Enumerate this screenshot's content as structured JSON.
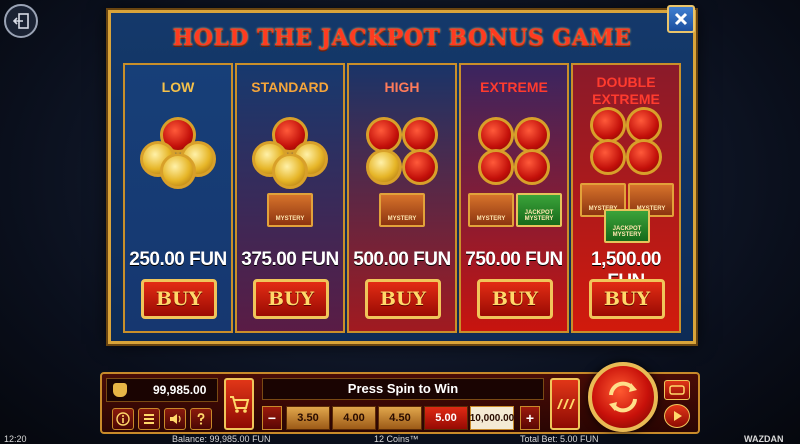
{
  "title": "HOLD THE JACKPOT BONUS GAME",
  "tiers": [
    {
      "name": "LOW",
      "price": "250.00 FUN",
      "buy": "BUY",
      "name_color": "#f5c14a",
      "bg_top": "#173f78",
      "bg_bottom": "#163770"
    },
    {
      "name": "STANDARD",
      "price": "375.00 FUN",
      "buy": "BUY",
      "name_color": "#f5a53a",
      "bg_top": "#17396e",
      "bg_bottom": "#5a1c45"
    },
    {
      "name": "HIGH",
      "price": "500.00 FUN",
      "buy": "BUY",
      "name_color": "#ff7b5a",
      "bg_top": "#1a3468",
      "bg_bottom": "#a11a20"
    },
    {
      "name": "EXTREME",
      "price": "750.00 FUN",
      "buy": "BUY",
      "name_color": "#ff3b2e",
      "bg_top": "#3a2560",
      "bg_bottom": "#c8140e"
    },
    {
      "name": "DOUBLE EXTREME",
      "name_line1": "DOUBLE",
      "name_line2": "EXTREME",
      "price": "1,500.00 FUN",
      "buy": "BUY",
      "name_color": "#ff3b2e",
      "bg_top": "#8a1a2a",
      "bg_bottom": "#d11a0c"
    }
  ],
  "mystery_labels": {
    "mystery": "MYSTERY",
    "jackpot_mystery": "JACKPOT MYSTERY"
  },
  "bottom": {
    "balance": "99,985.00",
    "status": "Press Spin to Win",
    "bet_options": [
      "3.50",
      "4.00",
      "4.50",
      "5.00",
      "10,000.00"
    ],
    "selected_bet": "5.00",
    "minus": "−",
    "plus": "+"
  },
  "footer": {
    "time": "12:20",
    "balance_text": "Balance: 99,985.00 FUN",
    "coins_text": "12 Coins™",
    "total_bet_text": "Total Bet: 5.00 FUN",
    "brand": "WAZDAN"
  },
  "icons": {
    "exit": "exit-icon",
    "close": "close-icon",
    "bag": "money-bag-icon",
    "info": "info-icon",
    "menu": "menu-icon",
    "sound": "sound-icon",
    "help": "help-icon",
    "cart": "cart-icon",
    "turbo": "turbo-icon",
    "spin": "spin-icon",
    "autoplay": "autoplay-icon",
    "play": "play-icon"
  }
}
